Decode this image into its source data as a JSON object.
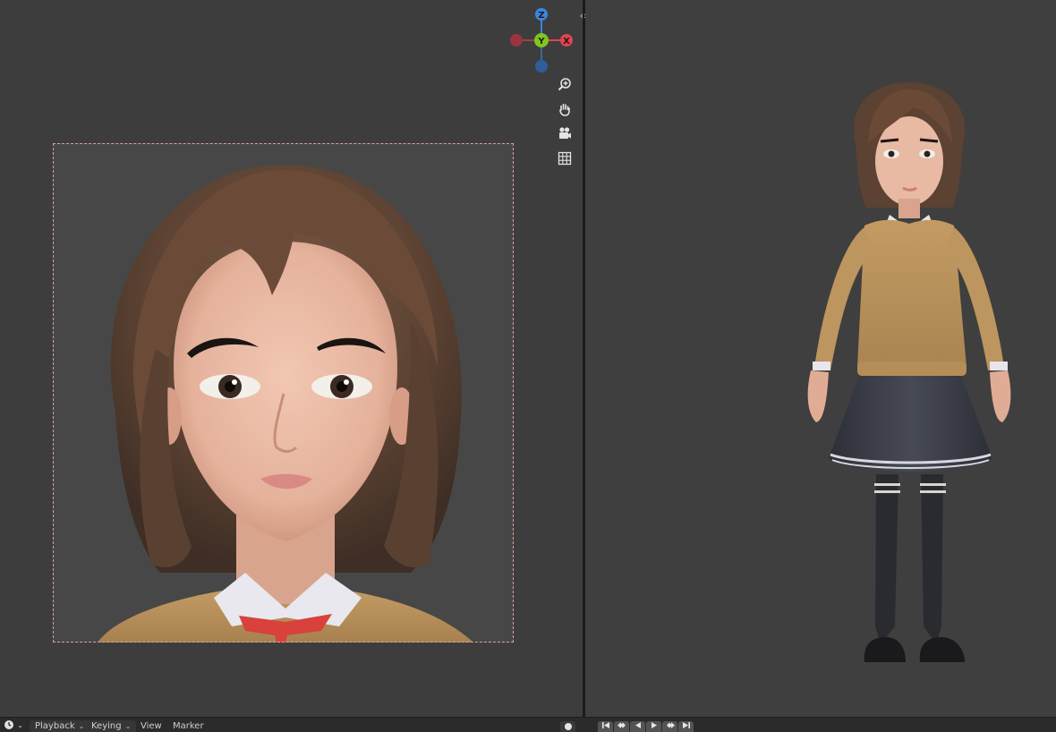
{
  "viewport_left": {
    "gizmo": {
      "x_label": "X",
      "y_label": "Y",
      "z_label": "Z"
    },
    "nav_tools": [
      "zoom-icon",
      "hand-pan-icon",
      "camera-icon",
      "grid-icon"
    ]
  },
  "divider": {
    "split_glyph": "‹›"
  },
  "timeline": {
    "editor_icon": "clock-icon",
    "playback_label": "Playback",
    "keying_label": "Keying",
    "view_label": "View",
    "marker_label": "Marker",
    "chevron": "⌄",
    "transport_icons": [
      "jump-start-icon",
      "prev-keyframe-icon",
      "play-reverse-icon",
      "play-icon",
      "next-keyframe-icon",
      "jump-end-icon"
    ]
  },
  "colors": {
    "axis_x": "#e2434f",
    "axis_y": "#7fc81b",
    "axis_z": "#3a86e0",
    "camera_border": "#d9a49b"
  }
}
